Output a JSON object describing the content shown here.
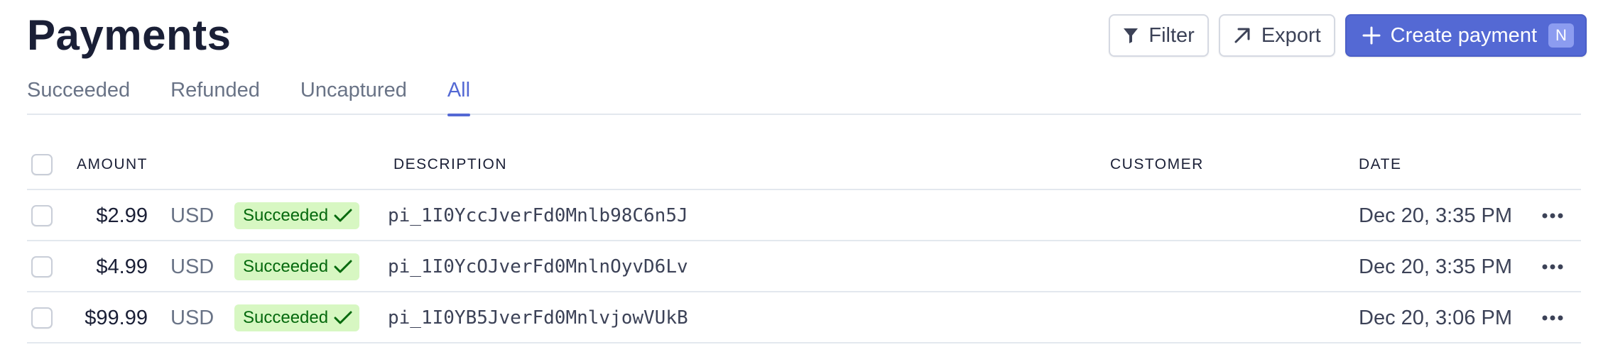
{
  "header": {
    "title": "Payments",
    "filter_label": "Filter",
    "export_label": "Export",
    "create_label": "Create payment",
    "create_shortcut": "N",
    "icons": {
      "filter": "filter-funnel-icon",
      "export": "arrow-up-right-icon",
      "create": "plus-icon"
    }
  },
  "tabs": [
    {
      "label": "Succeeded",
      "active": false
    },
    {
      "label": "Refunded",
      "active": false
    },
    {
      "label": "Uncaptured",
      "active": false
    },
    {
      "label": "All",
      "active": true
    }
  ],
  "table": {
    "columns": {
      "amount": "AMOUNT",
      "description": "DESCRIPTION",
      "customer": "CUSTOMER",
      "date": "DATE"
    },
    "rows": [
      {
        "amount": "$2.99",
        "currency": "USD",
        "status": "Succeeded",
        "description": "pi_1I0YccJverFd0Mnlb98C6n5J",
        "customer": "",
        "date": "Dec 20, 3:35 PM"
      },
      {
        "amount": "$4.99",
        "currency": "USD",
        "status": "Succeeded",
        "description": "pi_1I0YcOJverFd0MnlnOyvD6Lv",
        "customer": "",
        "date": "Dec 20, 3:35 PM"
      },
      {
        "amount": "$99.99",
        "currency": "USD",
        "status": "Succeeded",
        "description": "pi_1I0YB5JverFd0MnlvjowVUkB",
        "customer": "",
        "date": "Dec 20, 3:06 PM"
      }
    ]
  },
  "colors": {
    "accent": "#5469d4",
    "badge_bg": "#d7f7c2",
    "badge_text": "#05690d",
    "text": "#1a1f36",
    "muted": "#697386"
  }
}
